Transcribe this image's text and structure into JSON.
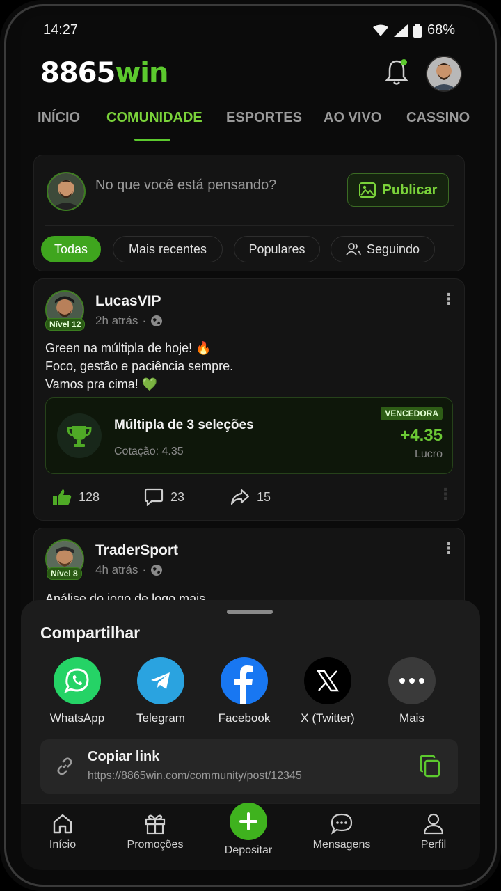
{
  "status": {
    "time": "14:27",
    "battery": "68%"
  },
  "header": {
    "brand_main": "8865",
    "brand_accent": "win"
  },
  "tabs": [
    {
      "label": "INÍCIO"
    },
    {
      "label": "COMUNIDADE"
    },
    {
      "label": "ESPORTES"
    },
    {
      "label": "AO VIVO"
    },
    {
      "label": "CASSINO"
    }
  ],
  "composer": {
    "placeholder": "No que você está pensando?",
    "publish_label": "Publicar",
    "filters": [
      {
        "label": "Todas"
      },
      {
        "label": "Mais recentes"
      },
      {
        "label": "Populares"
      },
      {
        "label": "Seguindo"
      }
    ]
  },
  "posts": [
    {
      "username": "LucasVIP",
      "level": "Nível 12",
      "time": "2h atrás",
      "text_lines": [
        "Green na múltipla de hoje! 🔥",
        "Foco, gestão e paciência sempre.",
        "Vamos pra cima! 💚"
      ],
      "bet": {
        "title": "Múltipla de 3 seleções",
        "odds": "Cotação: 4.35",
        "badge": "VENCEDORA",
        "profit": "+4.35",
        "profit_label": "Lucro"
      },
      "likes": "128",
      "comments": "23",
      "shares": "15"
    },
    {
      "username": "TraderSport",
      "level": "Nível 8",
      "time": "4h atrás",
      "text_preview": "Análise do jogo de logo mais."
    }
  ],
  "share_sheet": {
    "title": "Compartilhar",
    "options": [
      {
        "label": "WhatsApp",
        "color": "#25D366"
      },
      {
        "label": "Telegram",
        "color": "#2AA3E0"
      },
      {
        "label": "Facebook",
        "color": "#1877F2"
      },
      {
        "label": "X (Twitter)",
        "color": "#000000"
      },
      {
        "label": "Mais",
        "color": "#3a3a3a"
      }
    ],
    "copy_title": "Copiar link",
    "copy_url": "https://8865win.com/community/post/12345"
  },
  "bottom_nav": [
    {
      "label": "Início"
    },
    {
      "label": "Promoções"
    },
    {
      "label": "Depositar"
    },
    {
      "label": "Mensagens"
    },
    {
      "label": "Perfil"
    }
  ],
  "colors": {
    "accent": "#5cc92e",
    "background": "#0b0b0b"
  }
}
